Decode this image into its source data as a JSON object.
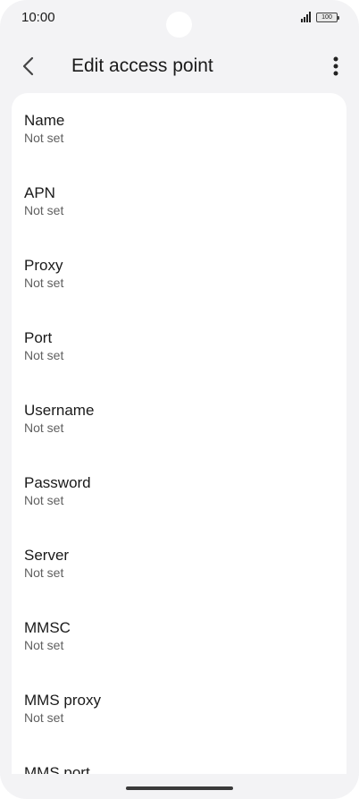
{
  "status_bar": {
    "time": "10:00",
    "battery": "100"
  },
  "header": {
    "title": "Edit access point",
    "back_icon": "chevron-left-icon",
    "more_icon": "more-vertical-icon"
  },
  "settings": [
    {
      "label": "Name",
      "value": "Not set"
    },
    {
      "label": "APN",
      "value": "Not set"
    },
    {
      "label": "Proxy",
      "value": "Not set"
    },
    {
      "label": "Port",
      "value": "Not set"
    },
    {
      "label": "Username",
      "value": "Not set"
    },
    {
      "label": "Password",
      "value": "Not set"
    },
    {
      "label": "Server",
      "value": "Not set"
    },
    {
      "label": "MMSC",
      "value": "Not set"
    },
    {
      "label": "MMS proxy",
      "value": "Not set"
    },
    {
      "label": "MMS port",
      "value": ""
    }
  ]
}
